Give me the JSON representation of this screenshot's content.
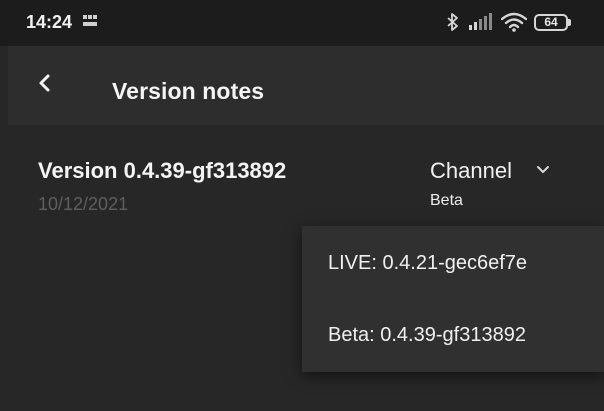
{
  "status_bar": {
    "time": "14:24",
    "notification_icon": "bbc-news-icon",
    "battery": "64"
  },
  "app_bar": {
    "back_icon": "back-arrow-icon",
    "title": "Version notes"
  },
  "release": {
    "version": "Version 0.4.39-gf313892",
    "date": "10/12/2021"
  },
  "channel": {
    "label": "Channel",
    "selected": "Beta",
    "options": [
      "LIVE: 0.4.21-gec6ef7e",
      "Beta: 0.4.39-gf313892"
    ]
  },
  "colors": {
    "background": "#272727",
    "status_bar": "#1c1c1c",
    "app_bar": "#2d2d2d",
    "dropdown": "#303030",
    "date_text": "#5e5e5e"
  }
}
